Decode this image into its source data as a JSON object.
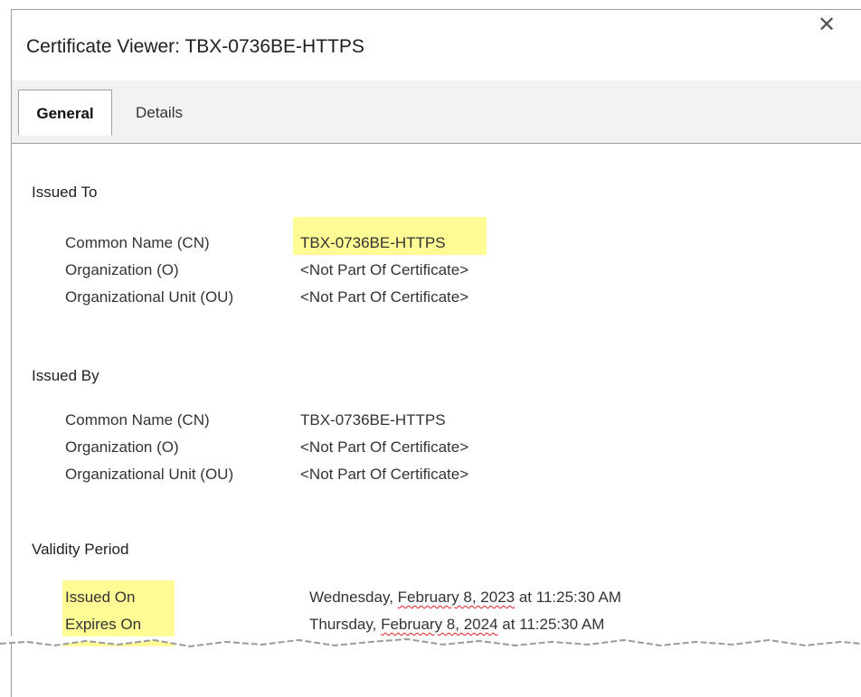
{
  "window": {
    "title": "Certificate Viewer: TBX-0736BE-HTTPS",
    "close_icon": "close-icon",
    "close_glyph": "✕"
  },
  "tabs": [
    {
      "label": "General",
      "selected": true
    },
    {
      "label": "Details",
      "selected": false
    }
  ],
  "issued_to": {
    "heading": "Issued To",
    "rows": [
      {
        "label": "Common Name (CN)",
        "value": "TBX-0736BE-HTTPS"
      },
      {
        "label": "Organization (O)",
        "value": "<Not Part Of Certificate>"
      },
      {
        "label": "Organizational Unit (OU)",
        "value": "<Not Part Of Certificate>"
      }
    ]
  },
  "issued_by": {
    "heading": "Issued By",
    "rows": [
      {
        "label": "Common Name (CN)",
        "value": "TBX-0736BE-HTTPS"
      },
      {
        "label": "Organization (O)",
        "value": "<Not Part Of Certificate>"
      },
      {
        "label": "Organizational Unit (OU)",
        "value": "<Not Part Of Certificate>"
      }
    ]
  },
  "validity": {
    "heading": "Validity Period",
    "issued_on": {
      "label": "Issued On",
      "day": "Wednesday, ",
      "date": "February 8, 2023",
      "time": " at 11:25:30 AM"
    },
    "expires_on": {
      "label": "Expires On",
      "day": "Thursday, ",
      "date": "February 8, 2024",
      "time": " at 11:25:30 AM"
    }
  },
  "colors": {
    "highlight": "#fffb95",
    "spellcheck_underline": "#e02020",
    "tabbar_background": "#f2f2f2"
  }
}
